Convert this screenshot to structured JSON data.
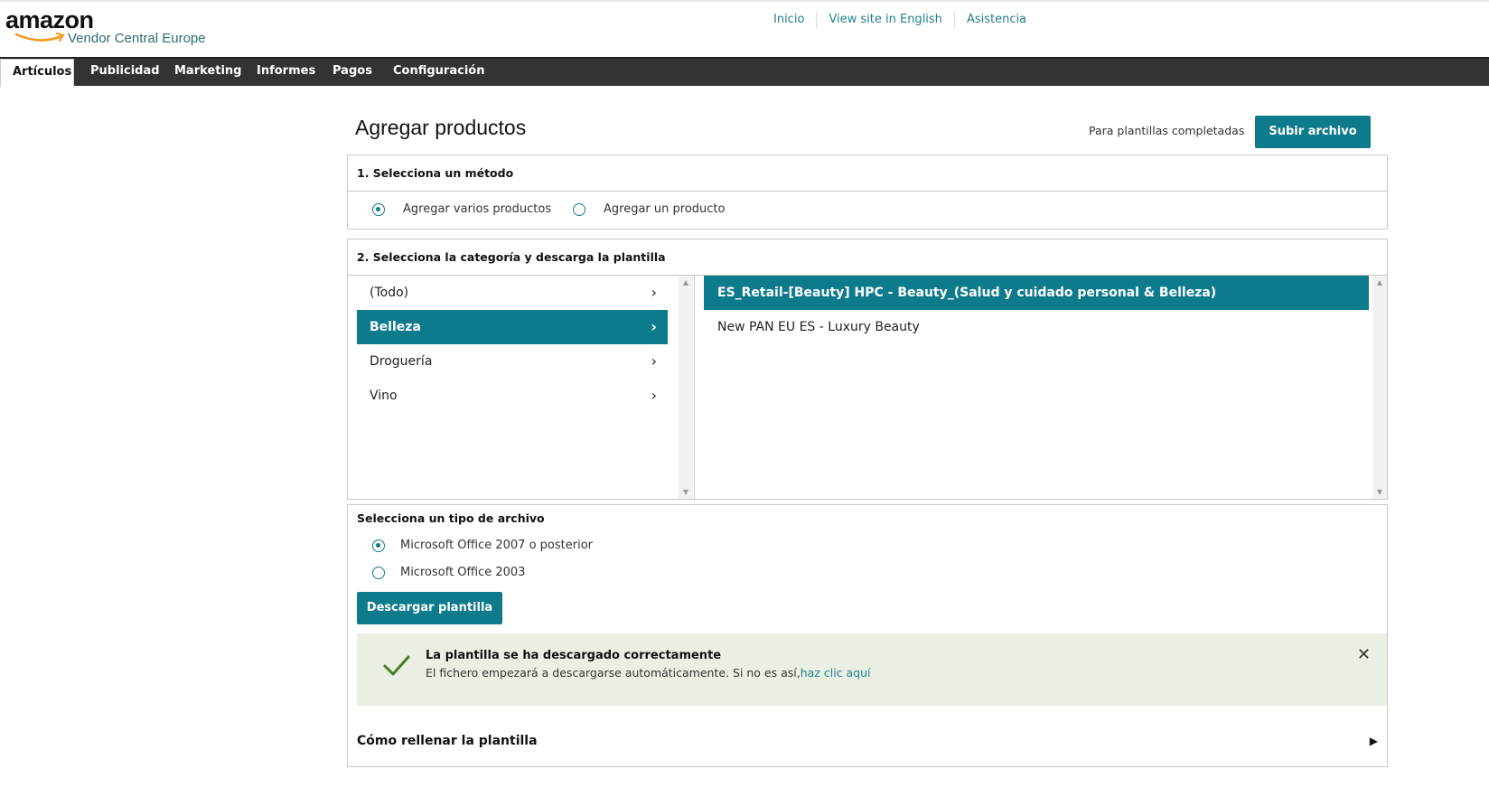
{
  "header": {
    "logo_text": "amazon",
    "logo_subtitle": "Vendor Central Europe",
    "links": [
      "Inicio",
      "View site in English",
      "Asistencia"
    ]
  },
  "nav": {
    "tabs": [
      "Artículos",
      "Publicidad",
      "Marketing",
      "Informes",
      "Pagos",
      "Configuración"
    ],
    "active": "Artículos"
  },
  "page": {
    "title": "Agregar productos",
    "completed_label": "Para plantillas completadas",
    "upload_button": "Subir archivo"
  },
  "method": {
    "heading": "1. Selecciona un método",
    "options": [
      "Agregar varios productos",
      "Agregar un producto"
    ],
    "selected": "Agregar varios productos"
  },
  "category": {
    "heading": "2. Selecciona la categoría y descarga la plantilla",
    "categories": [
      "(Todo)",
      "Belleza",
      "Droguería",
      "Vino"
    ],
    "selected_category": "Belleza",
    "templates": [
      "ES_Retail-[Beauty] HPC - Beauty_(Salud y cuidado personal & Belleza)",
      "New PAN EU ES - Luxury Beauty"
    ],
    "selected_template": "ES_Retail-[Beauty] HPC - Beauty_(Salud y cuidado personal & Belleza)"
  },
  "filetype": {
    "heading": "Selecciona un tipo de archivo",
    "options": [
      "Microsoft Office 2007 o posterior",
      "Microsoft Office 2003"
    ],
    "selected": "Microsoft Office 2007 o posterior",
    "download_button": "Descargar plantilla"
  },
  "alert": {
    "title": "La plantilla se ha descargado correctamente",
    "message": "El fichero empezará a descargarse automáticamente. Si no es así,",
    "link": "haz clic aquí"
  },
  "howto": {
    "label": "Cómo rellenar la plantilla"
  },
  "colors": {
    "accent": "#0e7b8d",
    "nav_bg": "#333333",
    "alert_bg": "#e9efe3",
    "success": "#4a7a1f"
  },
  "icons": [
    "chevron-right-icon",
    "checkmark-icon",
    "close-icon",
    "caret-right-icon"
  ]
}
